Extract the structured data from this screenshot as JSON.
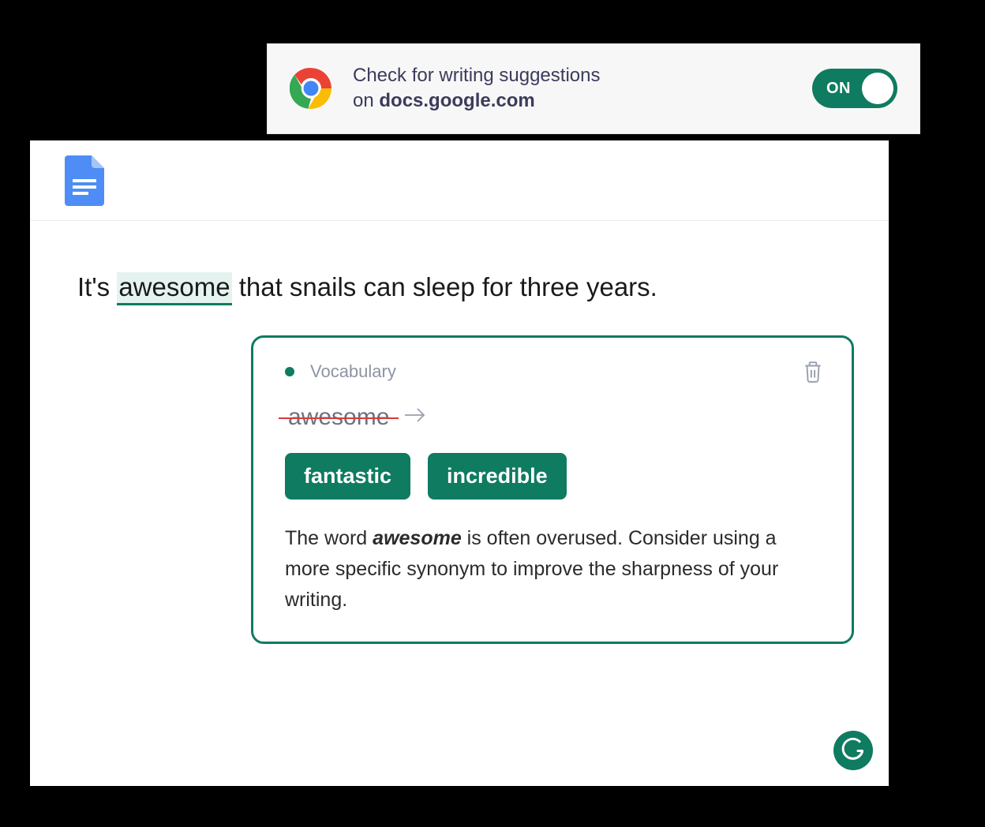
{
  "banner": {
    "line1": "Check for writing suggestions",
    "line2_prefix": "on ",
    "line2_domain": "docs.google.com",
    "toggle_label": "ON"
  },
  "doc": {
    "sentence_pre": "It's ",
    "flagged_word": "awesome",
    "sentence_post": " that snails can sleep for three years."
  },
  "card": {
    "category": "Vocabulary",
    "original_word": "awesome",
    "suggestions": [
      "fantastic",
      "incredible"
    ],
    "explain_pre": "The word ",
    "explain_word": "awesome",
    "explain_post": " is often overused. Consider using a more specific synonym to improve the sharpness of your writing."
  }
}
